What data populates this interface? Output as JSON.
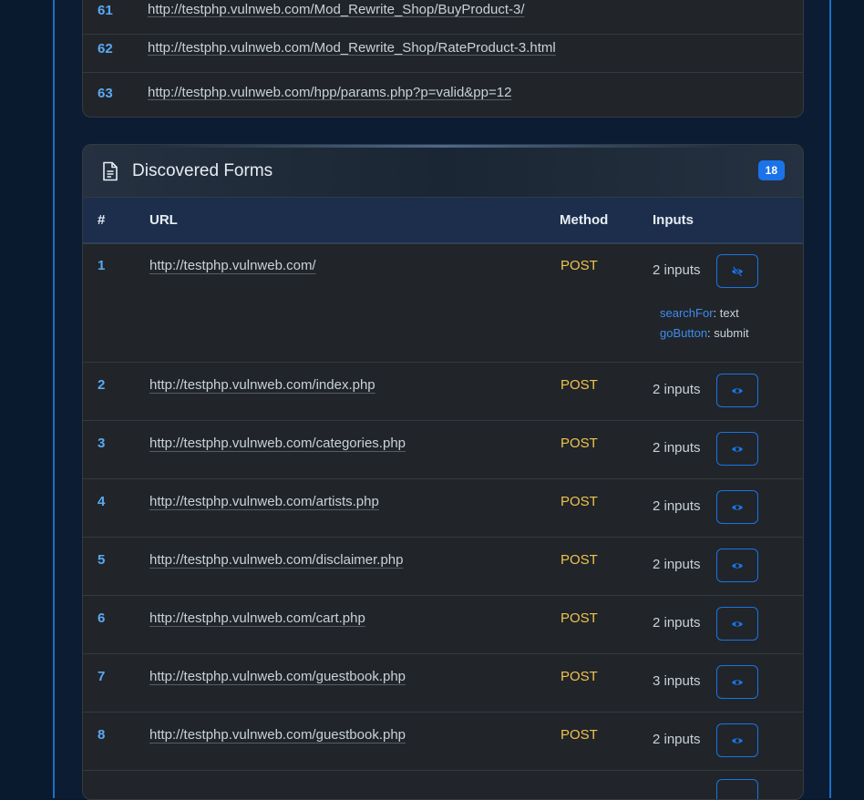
{
  "links": [
    {
      "num": "61",
      "url": "http://testphp.vulnweb.com/Mod_Rewrite_Shop/BuyProduct-3/"
    },
    {
      "num": "62",
      "url": "http://testphp.vulnweb.com/Mod_Rewrite_Shop/RateProduct-3.html"
    },
    {
      "num": "63",
      "url": "http://testphp.vulnweb.com/hpp/params.php?p=valid&pp=12"
    }
  ],
  "forms": {
    "title": "Discovered Forms",
    "count": "18",
    "columns": {
      "num": "#",
      "url": "URL",
      "method": "Method",
      "inputs": "Inputs"
    },
    "rows": [
      {
        "num": "1",
        "url": "http://testphp.vulnweb.com/",
        "method": "POST",
        "inputs": "2 inputs",
        "expanded": true,
        "fields": [
          {
            "name": "searchFor",
            "type": "text"
          },
          {
            "name": "goButton",
            "type": "submit"
          }
        ]
      },
      {
        "num": "2",
        "url": "http://testphp.vulnweb.com/index.php",
        "method": "POST",
        "inputs": "2 inputs"
      },
      {
        "num": "3",
        "url": "http://testphp.vulnweb.com/categories.php",
        "method": "POST",
        "inputs": "2 inputs"
      },
      {
        "num": "4",
        "url": "http://testphp.vulnweb.com/artists.php",
        "method": "POST",
        "inputs": "2 inputs"
      },
      {
        "num": "5",
        "url": "http://testphp.vulnweb.com/disclaimer.php",
        "method": "POST",
        "inputs": "2 inputs"
      },
      {
        "num": "6",
        "url": "http://testphp.vulnweb.com/cart.php",
        "method": "POST",
        "inputs": "2 inputs"
      },
      {
        "num": "7",
        "url": "http://testphp.vulnweb.com/guestbook.php",
        "method": "POST",
        "inputs": "3 inputs"
      },
      {
        "num": "8",
        "url": "http://testphp.vulnweb.com/guestbook.php",
        "method": "POST",
        "inputs": "2 inputs"
      }
    ]
  },
  "icons": {
    "eye": "eye-icon",
    "eye_off": "eye-off-icon",
    "doc": "document-icon"
  },
  "colors": {
    "accent": "#1a73e8",
    "method": "#f1c24e",
    "index": "#5aa9f5"
  }
}
